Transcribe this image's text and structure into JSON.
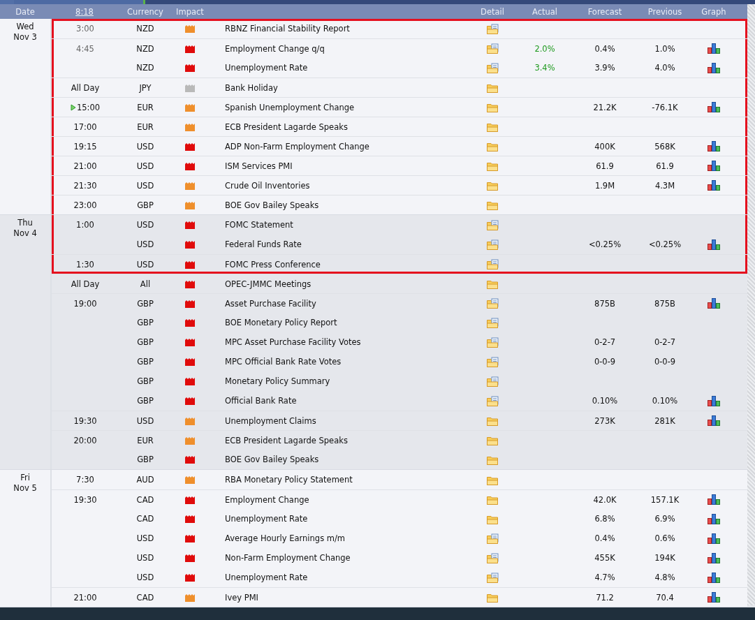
{
  "header": {
    "columns": [
      {
        "kind": "date",
        "label": "Date"
      },
      {
        "kind": "time",
        "label": "8:18"
      },
      {
        "kind": "currency",
        "label": "Currency"
      },
      {
        "kind": "impact",
        "label": "Impact"
      },
      {
        "kind": "event"
      },
      {
        "kind": "detail",
        "label": "Detail"
      },
      {
        "kind": "actual",
        "label": "Actual"
      },
      {
        "kind": "forecast",
        "label": "Forecast"
      },
      {
        "kind": "previous",
        "label": "Previous"
      },
      {
        "kind": "graph",
        "label": "Graph"
      }
    ]
  },
  "days": [
    {
      "weekday": "Wed",
      "date": "Nov 3",
      "shaded": false,
      "rows": [
        {
          "time": "3:00",
          "past": true,
          "next": false,
          "currency": "NZD",
          "impact": {
            "kind": "medium"
          },
          "event": "RBNZ Financial Stability Report",
          "detail": {
            "kind": "document"
          },
          "graph": false,
          "highlighted": true
        },
        {
          "time": "4:45",
          "past": true,
          "next": false,
          "currency": "NZD",
          "impact": {
            "kind": "high"
          },
          "event": "Employment Change q/q",
          "detail": {
            "kind": "document"
          },
          "actual": "2.0%",
          "actual_better": true,
          "forecast": "0.4%",
          "previous": "1.0%",
          "graph": true,
          "highlighted": true
        },
        {
          "next": false,
          "currency": "NZD",
          "impact": {
            "kind": "high"
          },
          "event": "Unemployment Rate",
          "detail": {
            "kind": "document"
          },
          "actual": "3.4%",
          "actual_better": true,
          "forecast": "3.9%",
          "previous": "4.0%",
          "graph": true,
          "highlighted": true
        },
        {
          "time": "All Day",
          "past": false,
          "next": false,
          "currency": "JPY",
          "impact": {
            "kind": "holiday"
          },
          "event": "Bank Holiday",
          "detail": {
            "kind": "folder"
          },
          "graph": false,
          "highlighted": true
        },
        {
          "time": "15:00",
          "past": false,
          "next": true,
          "currency": "EUR",
          "impact": {
            "kind": "medium"
          },
          "event": "Spanish Unemployment Change",
          "detail": {
            "kind": "folder"
          },
          "forecast": "21.2K",
          "previous": "-76.1K",
          "graph": true,
          "highlighted": true
        },
        {
          "time": "17:00",
          "past": false,
          "next": false,
          "currency": "EUR",
          "impact": {
            "kind": "medium"
          },
          "event": "ECB President Lagarde Speaks",
          "detail": {
            "kind": "folder"
          },
          "graph": false,
          "highlighted": true
        },
        {
          "time": "19:15",
          "past": false,
          "next": false,
          "currency": "USD",
          "impact": {
            "kind": "high"
          },
          "event": "ADP Non-Farm Employment Change",
          "detail": {
            "kind": "folder"
          },
          "forecast": "400K",
          "previous": "568K",
          "graph": true,
          "highlighted": true
        },
        {
          "time": "21:00",
          "past": false,
          "next": false,
          "currency": "USD",
          "impact": {
            "kind": "high"
          },
          "event": "ISM Services PMI",
          "detail": {
            "kind": "folder"
          },
          "forecast": "61.9",
          "previous": "61.9",
          "graph": true,
          "highlighted": true
        },
        {
          "time": "21:30",
          "past": false,
          "next": false,
          "currency": "USD",
          "impact": {
            "kind": "medium"
          },
          "event": "Crude Oil Inventories",
          "detail": {
            "kind": "folder"
          },
          "forecast": "1.9M",
          "previous": "4.3M",
          "graph": true,
          "highlighted": true
        },
        {
          "time": "23:00",
          "past": false,
          "next": false,
          "currency": "GBP",
          "impact": {
            "kind": "medium"
          },
          "event": "BOE Gov Bailey Speaks",
          "detail": {
            "kind": "folder"
          },
          "graph": false,
          "highlighted": true
        }
      ]
    },
    {
      "weekday": "Thu",
      "date": "Nov 4",
      "shaded": true,
      "rows": [
        {
          "time": "1:00",
          "past": false,
          "next": false,
          "currency": "USD",
          "impact": {
            "kind": "high"
          },
          "event": "FOMC Statement",
          "detail": {
            "kind": "document"
          },
          "graph": false,
          "highlighted": true
        },
        {
          "next": false,
          "currency": "USD",
          "impact": {
            "kind": "high"
          },
          "event": "Federal Funds Rate",
          "detail": {
            "kind": "document"
          },
          "forecast": "<0.25%",
          "previous": "<0.25%",
          "graph": true,
          "highlighted": true
        },
        {
          "time": "1:30",
          "past": false,
          "next": false,
          "currency": "USD",
          "impact": {
            "kind": "high"
          },
          "event": "FOMC Press Conference",
          "detail": {
            "kind": "document"
          },
          "graph": false,
          "highlighted": true
        },
        {
          "time": "All Day",
          "past": false,
          "next": false,
          "currency": "All",
          "impact": {
            "kind": "high"
          },
          "event": "OPEC-JMMC Meetings",
          "detail": {
            "kind": "folder"
          },
          "graph": false,
          "highlighted": false
        },
        {
          "time": "19:00",
          "past": false,
          "next": false,
          "currency": "GBP",
          "impact": {
            "kind": "high"
          },
          "event": "Asset Purchase Facility",
          "detail": {
            "kind": "document"
          },
          "forecast": "875B",
          "previous": "875B",
          "graph": true,
          "highlighted": false
        },
        {
          "next": false,
          "currency": "GBP",
          "impact": {
            "kind": "high"
          },
          "event": "BOE Monetary Policy Report",
          "detail": {
            "kind": "document"
          },
          "graph": false,
          "highlighted": false
        },
        {
          "next": false,
          "currency": "GBP",
          "impact": {
            "kind": "high"
          },
          "event": "MPC Asset Purchase Facility Votes",
          "detail": {
            "kind": "document"
          },
          "forecast": "0-2-7",
          "previous": "0-2-7",
          "graph": false,
          "highlighted": false
        },
        {
          "next": false,
          "currency": "GBP",
          "impact": {
            "kind": "high"
          },
          "event": "MPC Official Bank Rate Votes",
          "detail": {
            "kind": "document"
          },
          "forecast": "0-0-9",
          "previous": "0-0-9",
          "graph": false,
          "highlighted": false
        },
        {
          "next": false,
          "currency": "GBP",
          "impact": {
            "kind": "high"
          },
          "event": "Monetary Policy Summary",
          "detail": {
            "kind": "document"
          },
          "graph": false,
          "highlighted": false
        },
        {
          "next": false,
          "currency": "GBP",
          "impact": {
            "kind": "high"
          },
          "event": "Official Bank Rate",
          "detail": {
            "kind": "document"
          },
          "forecast": "0.10%",
          "previous": "0.10%",
          "graph": true,
          "highlighted": false
        },
        {
          "time": "19:30",
          "past": false,
          "next": false,
          "currency": "USD",
          "impact": {
            "kind": "medium"
          },
          "event": "Unemployment Claims",
          "detail": {
            "kind": "folder"
          },
          "forecast": "273K",
          "previous": "281K",
          "graph": true,
          "highlighted": false
        },
        {
          "time": "20:00",
          "past": false,
          "next": false,
          "currency": "EUR",
          "impact": {
            "kind": "medium"
          },
          "event": "ECB President Lagarde Speaks",
          "detail": {
            "kind": "folder"
          },
          "graph": false,
          "highlighted": false
        },
        {
          "next": false,
          "currency": "GBP",
          "impact": {
            "kind": "high"
          },
          "event": "BOE Gov Bailey Speaks",
          "detail": {
            "kind": "folder"
          },
          "graph": false,
          "highlighted": false
        }
      ]
    },
    {
      "weekday": "Fri",
      "date": "Nov 5",
      "shaded": false,
      "rows": [
        {
          "time": "7:30",
          "past": false,
          "next": false,
          "currency": "AUD",
          "impact": {
            "kind": "medium"
          },
          "event": "RBA Monetary Policy Statement",
          "detail": {
            "kind": "folder"
          },
          "graph": false,
          "highlighted": false
        },
        {
          "time": "19:30",
          "past": false,
          "next": false,
          "currency": "CAD",
          "impact": {
            "kind": "high"
          },
          "event": "Employment Change",
          "detail": {
            "kind": "folder"
          },
          "forecast": "42.0K",
          "previous": "157.1K",
          "graph": true,
          "highlighted": false
        },
        {
          "next": false,
          "currency": "CAD",
          "impact": {
            "kind": "high"
          },
          "event": "Unemployment Rate",
          "detail": {
            "kind": "folder"
          },
          "forecast": "6.8%",
          "previous": "6.9%",
          "graph": true,
          "highlighted": false
        },
        {
          "next": false,
          "currency": "USD",
          "impact": {
            "kind": "high"
          },
          "event": "Average Hourly Earnings m/m",
          "detail": {
            "kind": "document"
          },
          "forecast": "0.4%",
          "previous": "0.6%",
          "graph": true,
          "highlighted": false
        },
        {
          "next": false,
          "currency": "USD",
          "impact": {
            "kind": "high"
          },
          "event": "Non-Farm Employment Change",
          "detail": {
            "kind": "document"
          },
          "forecast": "455K",
          "previous": "194K",
          "graph": true,
          "highlighted": false
        },
        {
          "next": false,
          "currency": "USD",
          "impact": {
            "kind": "high"
          },
          "event": "Unemployment Rate",
          "detail": {
            "kind": "document"
          },
          "forecast": "4.7%",
          "previous": "4.8%",
          "graph": true,
          "highlighted": false
        },
        {
          "time": "21:00",
          "past": false,
          "next": false,
          "currency": "CAD",
          "impact": {
            "kind": "medium"
          },
          "event": "Ivey PMI",
          "detail": {
            "kind": "folder"
          },
          "forecast": "71.2",
          "previous": "70.4",
          "graph": true,
          "highlighted": false
        }
      ]
    }
  ]
}
